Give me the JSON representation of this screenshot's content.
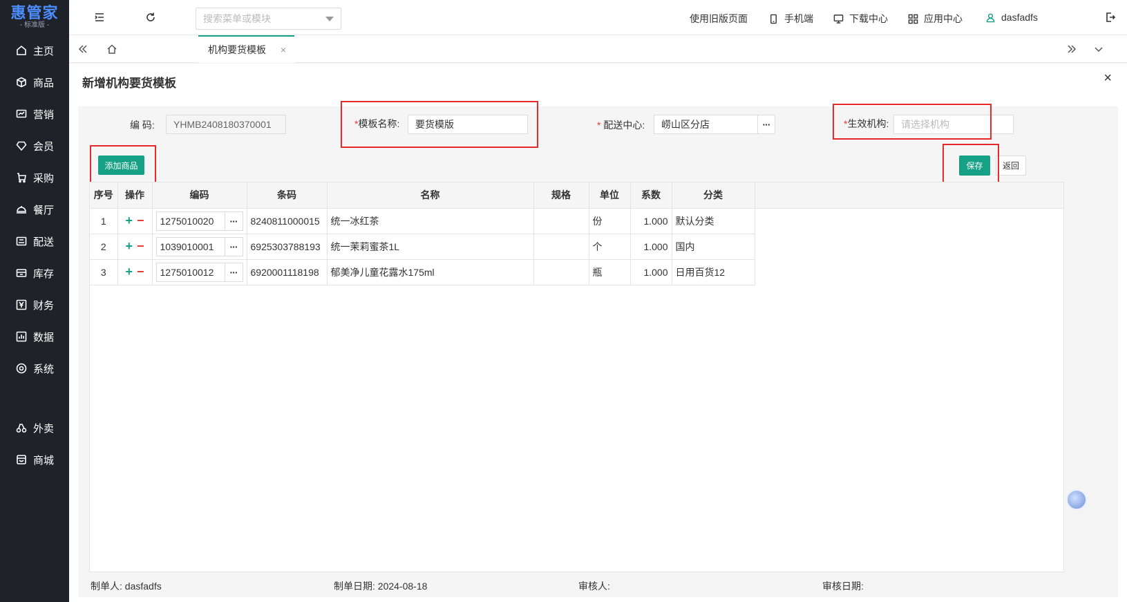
{
  "sidebar": {
    "logo": "惠管家",
    "edition": "- 标准版 -",
    "items": [
      {
        "label": "主页",
        "icon": "home-icon"
      },
      {
        "label": "商品",
        "icon": "box-icon"
      },
      {
        "label": "营销",
        "icon": "chart-icon"
      },
      {
        "label": "会员",
        "icon": "diamond-icon"
      },
      {
        "label": "采购",
        "icon": "receipt-icon"
      },
      {
        "label": "餐厅",
        "icon": "cloche-icon"
      },
      {
        "label": "配送",
        "icon": "truck-icon"
      },
      {
        "label": "库存",
        "icon": "inventory-icon"
      },
      {
        "label": "财务",
        "icon": "yen-icon"
      },
      {
        "label": "数据",
        "icon": "bar-chart-icon"
      },
      {
        "label": "系统",
        "icon": "settings-icon"
      },
      {
        "label": "外卖",
        "icon": "delivery-icon"
      },
      {
        "label": "商城",
        "icon": "shop-icon"
      }
    ]
  },
  "topbar": {
    "search_placeholder": "搜索菜单或模块",
    "links": {
      "old_version": "使用旧版页面",
      "mobile": "手机端",
      "download": "下载中心",
      "apps": "应用中心",
      "user": "dasfadfs"
    }
  },
  "tabs": {
    "active": "机构要货模板",
    "close": "×"
  },
  "page": {
    "title": "新增机构要货模板",
    "close": "×"
  },
  "form": {
    "code_label": "编  码:",
    "code_value": "YHMB2408180370001",
    "template_name_label": "模板名称:",
    "template_name_value": "要货模版",
    "center_label": "配送中心:",
    "center_value": "崂山区分店",
    "org_label": "生效机构:",
    "org_placeholder": "请选择机构",
    "required_mark": "*"
  },
  "toolbar": {
    "add_label": "添加商品",
    "save_label": "保存",
    "back_label": "返回"
  },
  "table": {
    "columns": [
      "序号",
      "操作",
      "编码",
      "条码",
      "名称",
      "规格",
      "单位",
      "系数",
      "分类"
    ],
    "rows": [
      {
        "index": "1",
        "code": "1275010020",
        "barcode": "8240811000015",
        "name": "统一冰红茶",
        "spec": "",
        "unit": "份",
        "factor": "1.000",
        "category": "默认分类"
      },
      {
        "index": "2",
        "code": "1039010001",
        "barcode": "6925303788193",
        "name": "统一茉莉蜜茶1L",
        "spec": "",
        "unit": "个",
        "factor": "1.000",
        "category": "国内"
      },
      {
        "index": "3",
        "code": "1275010012",
        "barcode": "6920001118198",
        "name": "郁美净儿童花露水175ml",
        "spec": "",
        "unit": "瓶",
        "factor": "1.000",
        "category": "日用百货12"
      }
    ]
  },
  "footer": {
    "creator_label": "制单人:",
    "creator_value": "dasfadfs",
    "date_label": "制单日期:",
    "date_value": "2024-08-18",
    "reviewer_label": "审核人:",
    "reviewer_value": "",
    "review_date_label": "审核日期:",
    "review_date_value": ""
  },
  "colors": {
    "accent": "#16a085",
    "highlight": "#e8282b",
    "sidebar_bg": "#1f2329",
    "logo": "#4c8dff"
  }
}
